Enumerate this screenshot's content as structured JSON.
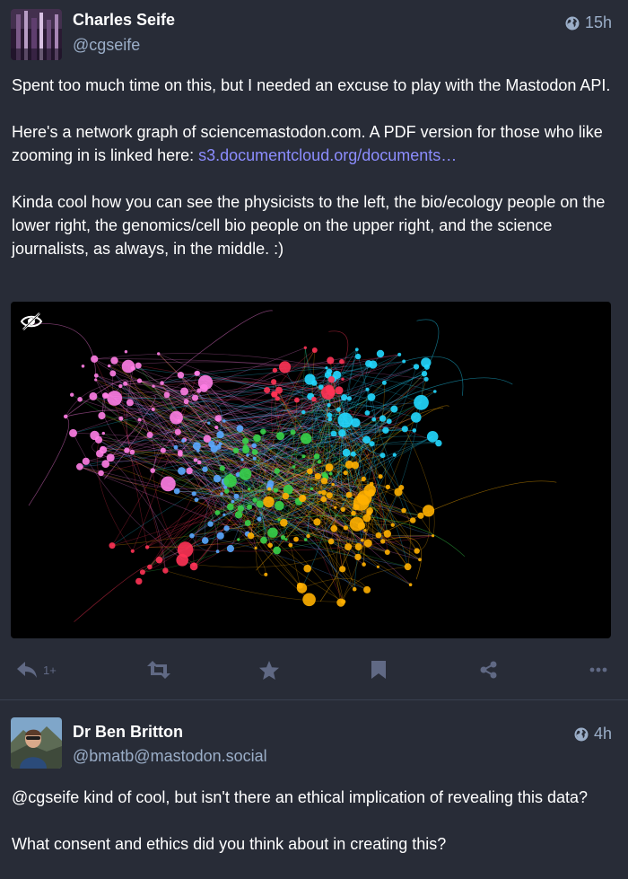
{
  "statuses": [
    {
      "display_name": "Charles Seife",
      "acct": "@cgseife",
      "visibility_icon": "globe-icon",
      "time": "15h",
      "content": {
        "p1": "Spent too much time on this, but I needed an excuse to play with the Mastodon API.",
        "p2_text": "Here's a network graph of sciencemastodon.com. A PDF version for those who like zooming in is linked here: ",
        "p2_link": "s3.documentcloud.org/documents…",
        "p3": "Kinda cool how you can see the physicists to the left,  the bio/ecology people on the lower right, the genomics/cell bio people on the upper right, and the science journalists, as always, in the middle. :)"
      },
      "media": {
        "description": "network graph",
        "hide_icon": "eye-slash-icon",
        "colors": {
          "pink": "#ff7ee5",
          "blue": "#5aa8ff",
          "green": "#37d24a",
          "orange": "#ffb000",
          "cyan": "#22d8ff",
          "red": "#ff3355"
        }
      },
      "actions": {
        "reply_icon": "reply-icon",
        "reply_count": "1+",
        "boost_icon": "boost-icon",
        "favourite_icon": "star-icon",
        "bookmark_icon": "bookmark-icon",
        "share_icon": "share-icon",
        "more_icon": "more-icon"
      }
    },
    {
      "display_name": "Dr Ben Britton",
      "acct": "@bmatb@mastodon.social",
      "visibility_icon": "globe-icon",
      "time": "4h",
      "content": {
        "p1": "@cgseife kind of cool, but isn't there an ethical implication of revealing this data?",
        "p2": "What consent and ethics did you think about in creating this?"
      }
    }
  ],
  "colors": {
    "background": "#282c37",
    "text": "#ffffff",
    "secondary": "#9baec8",
    "link": "#8c8dff",
    "action_icon": "#606984"
  }
}
